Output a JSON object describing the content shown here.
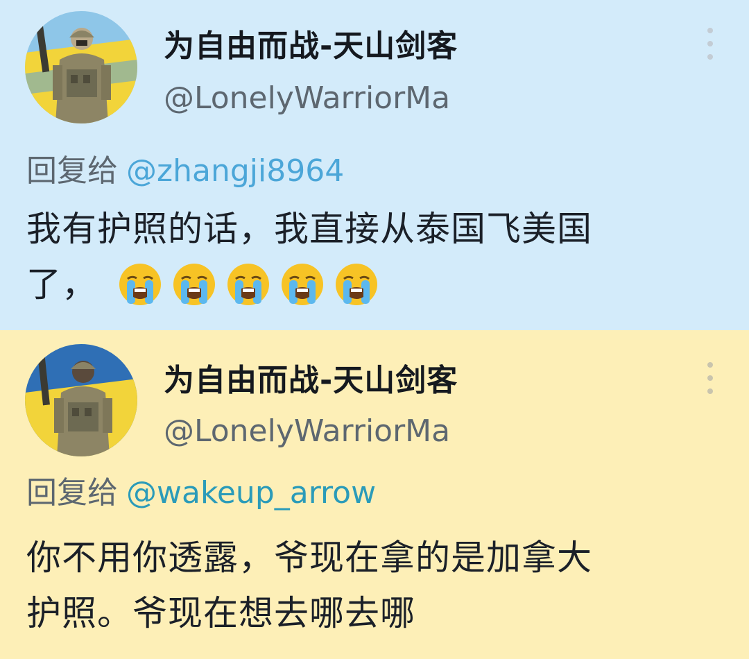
{
  "tweets": [
    {
      "display_name": "为自由而战-天山剑客",
      "handle": "@LonelyWarriorMa",
      "reply_prefix": "回复给",
      "reply_to": "@zhangji8964",
      "text_line1": "我有护照的话，我直接从泰国飞美国",
      "text_line2": "了，",
      "emoji": [
        "loudly-crying-face",
        "loudly-crying-face",
        "loudly-crying-face",
        "loudly-crying-face",
        "loudly-crying-face"
      ],
      "background": "#d3ebfa"
    },
    {
      "display_name": "为自由而战-天山剑客",
      "handle": "@LonelyWarriorMa",
      "reply_prefix": "回复给",
      "reply_to": "@wakeup_arrow",
      "text_line1": "你不用你透露，爷现在拿的是加拿大",
      "text_line2": "护照。爷现在想去哪去哪",
      "background": "#fdefb7"
    }
  ],
  "icons": {
    "more": "more-vertical-icon",
    "avatar": "soldier-avatar"
  },
  "colors": {
    "mention_blue": "#4ba6d8",
    "mention_teal": "#2b9bb9",
    "flag_yellow": "#f5d32a",
    "flag_blue": "#2f6fb5"
  }
}
